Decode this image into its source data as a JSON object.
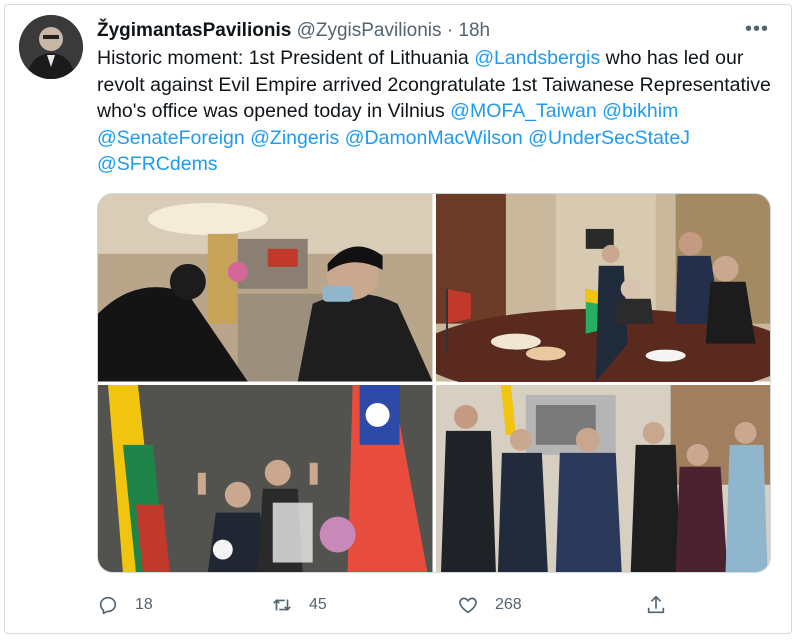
{
  "author": {
    "display_name": "ŽygimantasPavilionis",
    "handle": "@ZygisPavilionis",
    "separator": "·",
    "time": "18h"
  },
  "more_label": "•••",
  "tweet": {
    "segments": [
      {
        "text": "Historic moment: 1st President of Lithuania ",
        "type": "text"
      },
      {
        "text": "@Landsbergis",
        "type": "mention"
      },
      {
        "text": " who has led our revolt against Evil Empire arrived 2congratulate 1st Taiwanese Representative who's office was opened today in Vilnius ",
        "type": "text"
      },
      {
        "text": "@MOFA_Taiwan",
        "type": "mention"
      },
      {
        "text": " ",
        "type": "text"
      },
      {
        "text": "@bikhim",
        "type": "mention"
      },
      {
        "text": " ",
        "type": "text"
      },
      {
        "text": "@SenateForeign",
        "type": "mention"
      },
      {
        "text": " ",
        "type": "text"
      },
      {
        "text": "@Zingeris",
        "type": "mention"
      },
      {
        "text": " ",
        "type": "text"
      },
      {
        "text": "@DamonMacWilson",
        "type": "mention"
      },
      {
        "text": " ",
        "type": "text"
      },
      {
        "text": "@UnderSecStateJ",
        "type": "mention"
      },
      {
        "text": " ",
        "type": "text"
      },
      {
        "text": "@SFRCdems",
        "type": "mention"
      }
    ]
  },
  "photos": [
    {
      "icon": "photo-office-salute"
    },
    {
      "icon": "photo-meeting-table"
    },
    {
      "icon": "photo-flags-victory"
    },
    {
      "icon": "photo-group-victory"
    }
  ],
  "actions": {
    "reply_count": "18",
    "retweet_count": "45",
    "like_count": "268"
  },
  "colors": {
    "link": "#1d9bf0",
    "secondary_text": "#536471",
    "border": "#cfd9de"
  }
}
